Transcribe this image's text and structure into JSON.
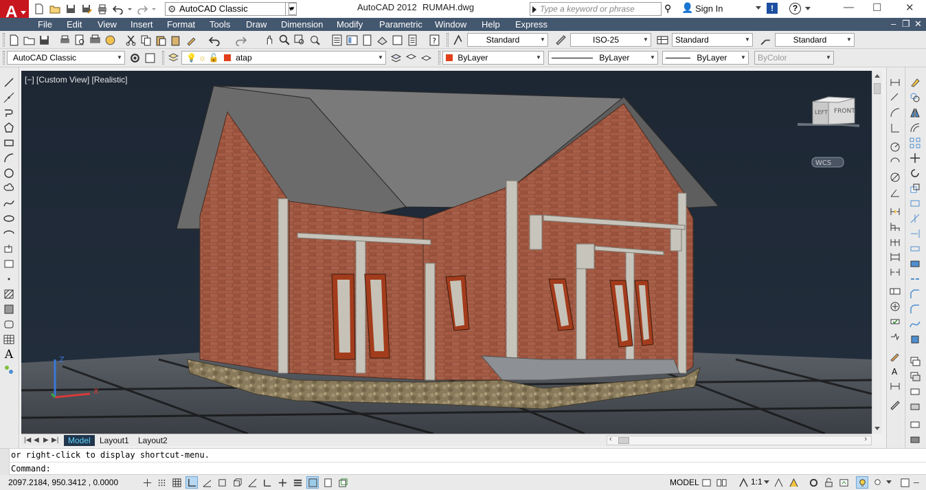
{
  "title_bar": {
    "app_title": "AutoCAD 2012",
    "file_name": "RUMAH.dwg",
    "workspace": "AutoCAD Classic",
    "search_placeholder": "Type a keyword or phrase",
    "sign_in": "Sign In",
    "logo_letter": "A",
    "help_glyph": "?",
    "exchange_glyph": "!"
  },
  "menu": {
    "items": [
      "File",
      "Edit",
      "View",
      "Insert",
      "Format",
      "Tools",
      "Draw",
      "Dimension",
      "Modify",
      "Parametric",
      "Window",
      "Help",
      "Express"
    ]
  },
  "styles_toolbar": {
    "text_style": "Standard",
    "dim_style": "ISO-25",
    "table_style": "Standard",
    "mleader_style": "Standard"
  },
  "layers_toolbar": {
    "workspace": "AutoCAD Classic",
    "current_layer": "atap",
    "layer_color": "#e2401c"
  },
  "properties_toolbar": {
    "color": "ByLayer",
    "color_swatch": "#e2401c",
    "linetype": "ByLayer",
    "lineweight": "ByLayer",
    "plot_style": "ByColor"
  },
  "viewport": {
    "label": "[−] [Custom View] [Realistic]",
    "viewcube_left": "LEFT",
    "viewcube_front": "FRONT",
    "wcs_label": "WCS",
    "axis_z": "Z",
    "axis_x": "X"
  },
  "tabs": {
    "items": [
      "Model",
      "Layout1",
      "Layout2"
    ],
    "active": "Model"
  },
  "command": {
    "history_line": "or right-click to display shortcut-menu.",
    "prompt": "Command:"
  },
  "status": {
    "coordinates": "2097.2184, 950.3412 , 0.0000",
    "space": "MODEL",
    "annotation_scale": "1:1"
  },
  "colors": {
    "menu_bg": "#43576f",
    "viewport_bg": "#1d2734",
    "accent_red": "#c8161e",
    "model_tab_text": "#5fd3ff"
  }
}
